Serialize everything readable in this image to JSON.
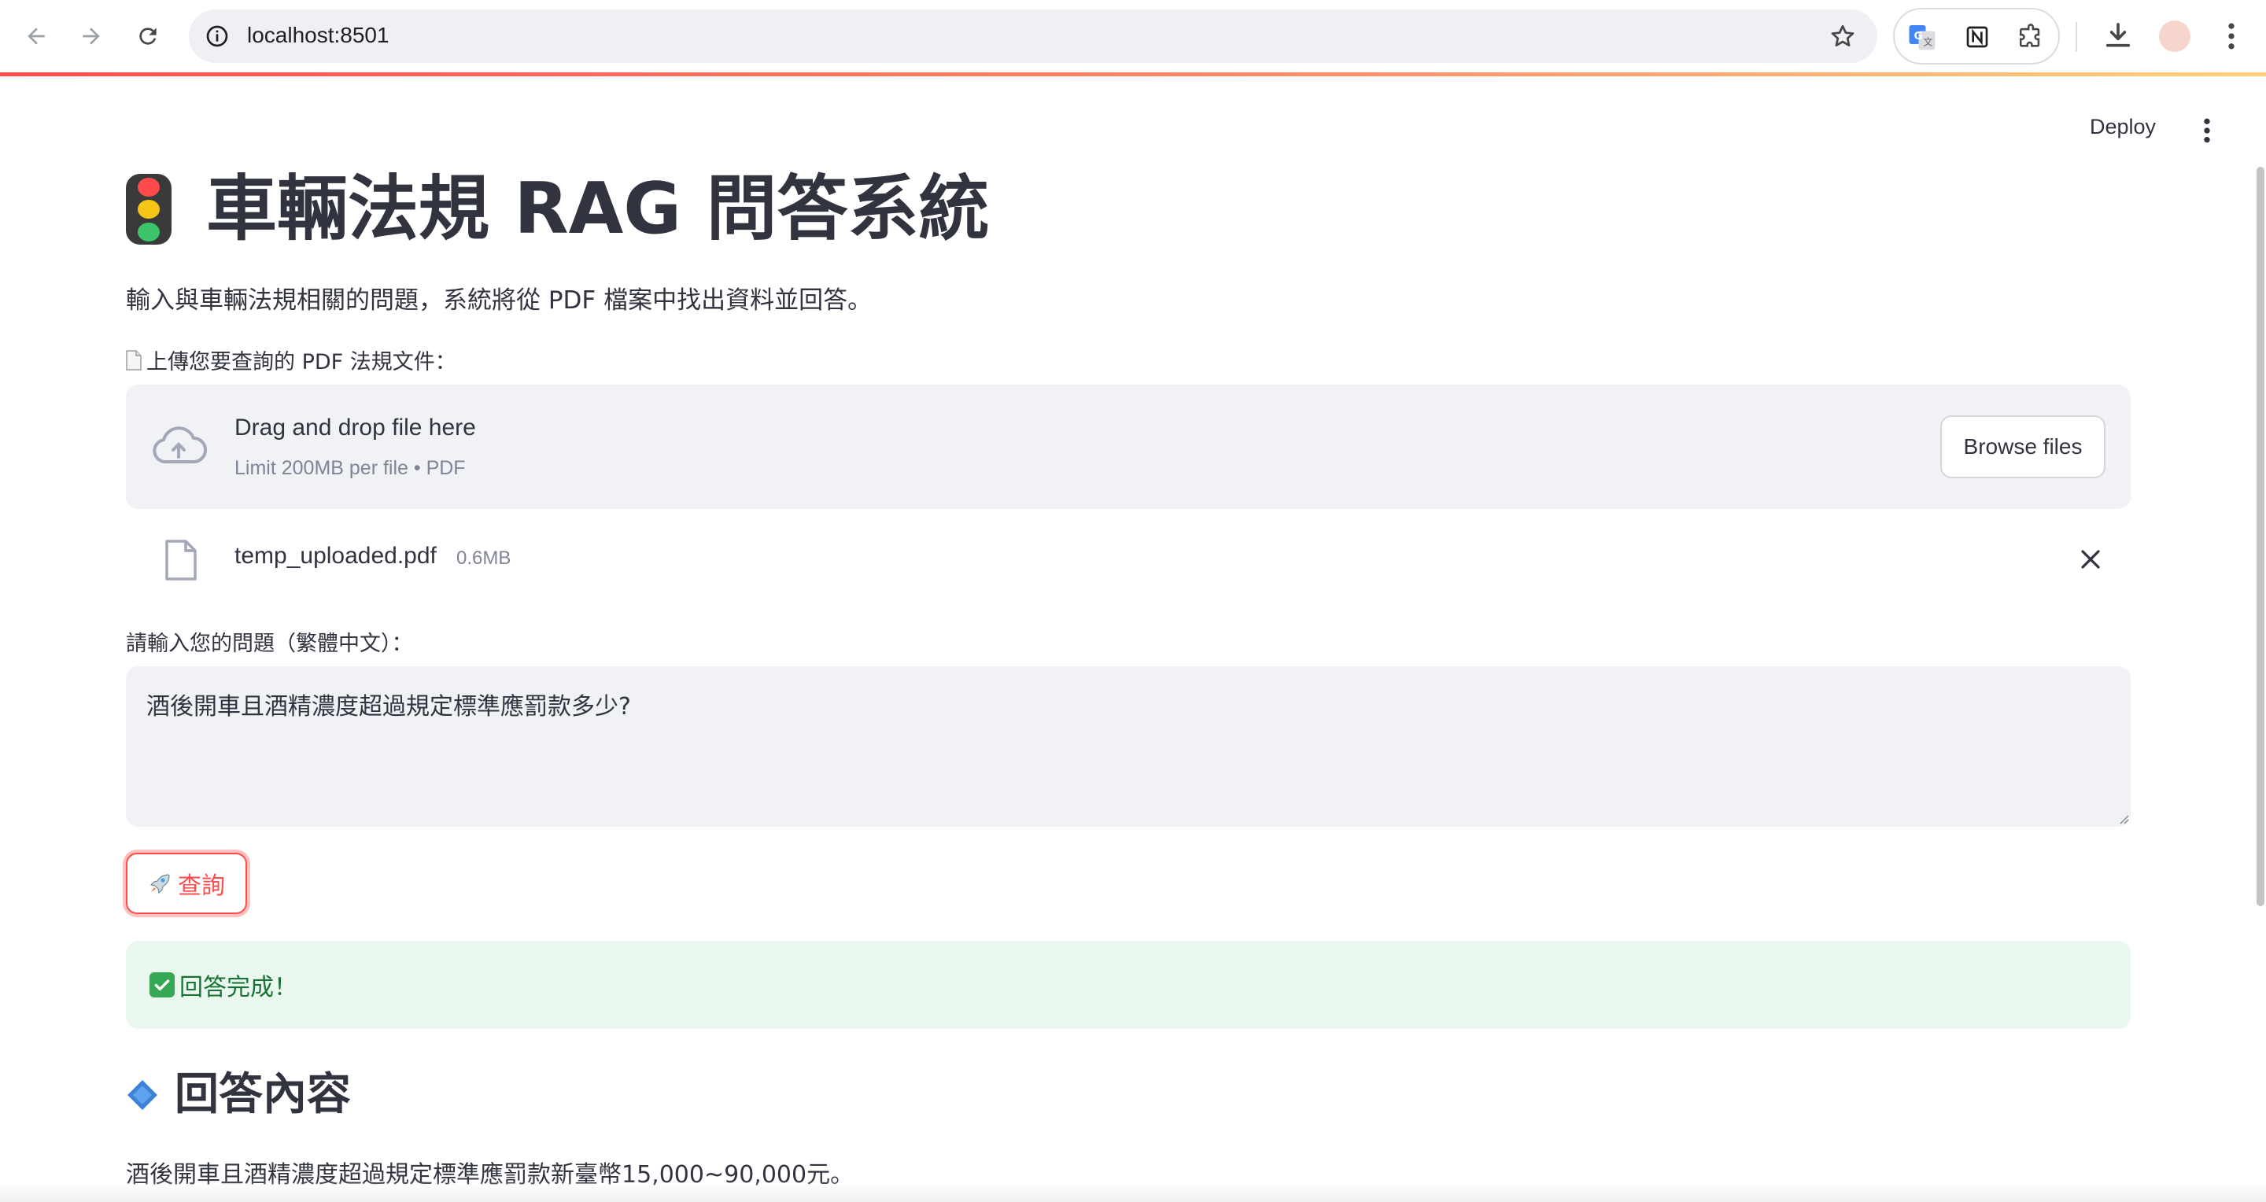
{
  "browser": {
    "url": "localhost:8501"
  },
  "app": {
    "deploy_label": "Deploy",
    "title": "車輛法規 RAG 問答系統",
    "subtitle": "輸入與車輛法規相關的問題，系統將從 PDF 檔案中找出資料並回答。",
    "upload": {
      "label": "上傳您要查詢的 PDF 法規文件：",
      "drop_title": "Drag and drop file here",
      "drop_subtitle": "Limit 200MB per file • PDF",
      "browse_label": "Browse files"
    },
    "uploaded_file": {
      "name": "temp_uploaded.pdf",
      "size": "0.6MB"
    },
    "question": {
      "label": "請輸入您的問題（繁體中文）：",
      "value": "酒後開車且酒精濃度超過規定標準應罰款多少?"
    },
    "query_button_label": "查詢",
    "success_message": "回答完成！",
    "answer": {
      "heading": "回答內容",
      "text": "酒後開車且酒精濃度超過規定標準應罰款新臺幣15,000~90,000元。"
    }
  },
  "colors": {
    "primary": "#ff4b4b",
    "success_bg": "#eaf7ee",
    "success_text": "#177233",
    "surface": "#f0f2f6"
  },
  "icons": [
    "back-icon",
    "forward-icon",
    "reload-icon",
    "site-info-icon",
    "star-icon",
    "translate-icon",
    "notion-icon",
    "extensions-icon",
    "download-icon",
    "profile-avatar",
    "more-vert-icon",
    "traffic-light-icon",
    "document-icon",
    "cloud-upload-icon",
    "file-icon",
    "close-icon",
    "rocket-icon",
    "check-mark-icon",
    "blue-diamond-icon"
  ]
}
